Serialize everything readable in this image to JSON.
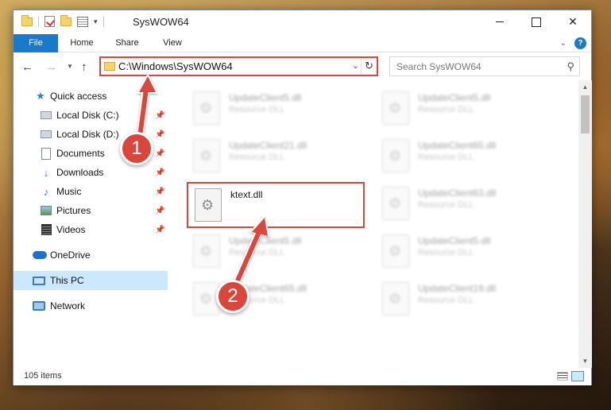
{
  "window": {
    "title": "SysWOW64",
    "caption": {
      "close": "✕"
    }
  },
  "ribbon": {
    "tabs": [
      {
        "label": "File"
      },
      {
        "label": "Home"
      },
      {
        "label": "Share"
      },
      {
        "label": "View"
      }
    ],
    "help_label": "?",
    "accent": "#1979ca"
  },
  "nav": {
    "address_path": "C:\\Windows\\SysWOW64",
    "search_placeholder": "Search SysWOW64"
  },
  "sidebar": {
    "items": [
      {
        "label": "Quick access",
        "icon": "star-icon"
      },
      {
        "label": "Local Disk (C:)",
        "icon": "disk-icon",
        "pinned": true
      },
      {
        "label": "Local Disk (D:)",
        "icon": "disk-icon",
        "pinned": true
      },
      {
        "label": "Documents",
        "icon": "document-icon",
        "pinned": true
      },
      {
        "label": "Downloads",
        "icon": "download-icon",
        "pinned": true
      },
      {
        "label": "Music",
        "icon": "music-icon",
        "pinned": true
      },
      {
        "label": "Pictures",
        "icon": "pictures-icon",
        "pinned": true
      },
      {
        "label": "Videos",
        "icon": "videos-icon",
        "pinned": true
      },
      {
        "label": "OneDrive",
        "icon": "cloud-icon"
      },
      {
        "label": "This PC",
        "icon": "computer-icon",
        "selected": true
      },
      {
        "label": "Network",
        "icon": "network-icon"
      }
    ]
  },
  "files": [
    {
      "name": "UpdateClient5.dll",
      "type": "Resource DLL"
    },
    {
      "name": "UpdateClient5.dll",
      "type": "Resource DLL"
    },
    {
      "name": "UpdateClient21.dll",
      "type": "Resource DLL"
    },
    {
      "name": "UpdateClient65.dll",
      "type": "Resource DLL"
    },
    {
      "name": "ktext.dll",
      "type": ""
    },
    {
      "name": "UpdateClient63.dll",
      "type": "Resource DLL"
    },
    {
      "name": "UpdateClient5.dll",
      "type": "Resource DLL"
    },
    {
      "name": "UpdateClient5.dll",
      "type": "Resource DLL"
    },
    {
      "name": "UpdateClient65.dll",
      "type": "Resource DLL"
    },
    {
      "name": "UpdateClient19.dll",
      "type": "Resource DLL"
    }
  ],
  "status": {
    "item_count": "105 items"
  },
  "annotations": [
    {
      "number": "1",
      "color": "#d9463c"
    },
    {
      "number": "2",
      "color": "#d9463c"
    }
  ]
}
